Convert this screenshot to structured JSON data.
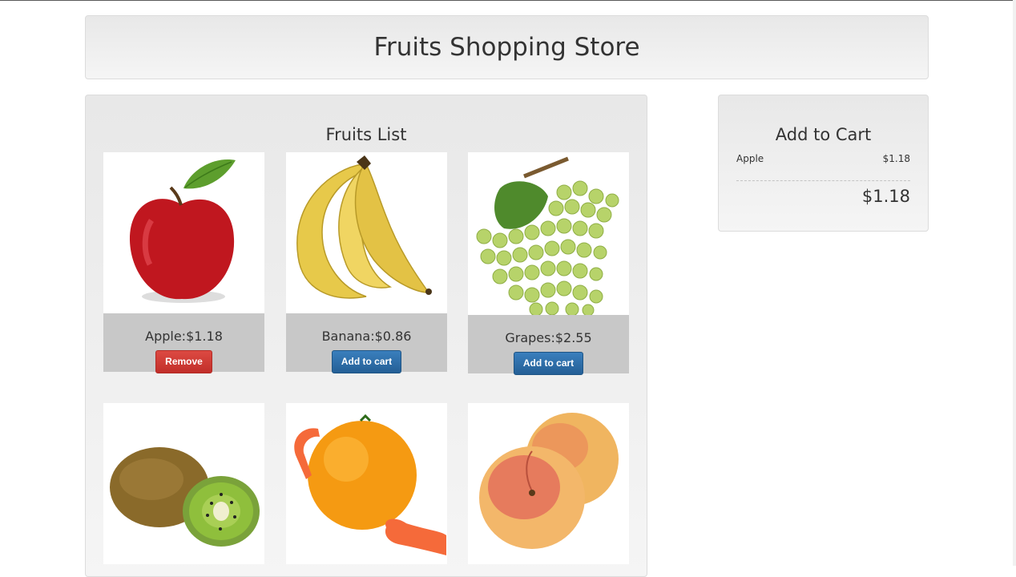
{
  "header": {
    "title": "Fruits Shopping Store"
  },
  "list": {
    "title": "Fruits List",
    "items": [
      {
        "label": "Apple:$1.18",
        "button": "Remove",
        "state": "in-cart",
        "icon": "apple-icon"
      },
      {
        "label": "Banana:$0.86",
        "button": "Add to cart",
        "state": "available",
        "icon": "banana-icon"
      },
      {
        "label": "Grapes:$2.55",
        "button": "Add to cart",
        "state": "available",
        "icon": "grapes-icon"
      },
      {
        "icon": "kiwi-icon"
      },
      {
        "icon": "orange-icon"
      },
      {
        "icon": "peach-icon"
      }
    ]
  },
  "cart": {
    "title": "Add to Cart",
    "items": [
      {
        "name": "Apple",
        "price": "$1.18"
      }
    ],
    "total": "$1.18"
  },
  "colors": {
    "remove": "#c9302c",
    "add": "#2d6ca2",
    "caption": "#c8c8c8"
  }
}
